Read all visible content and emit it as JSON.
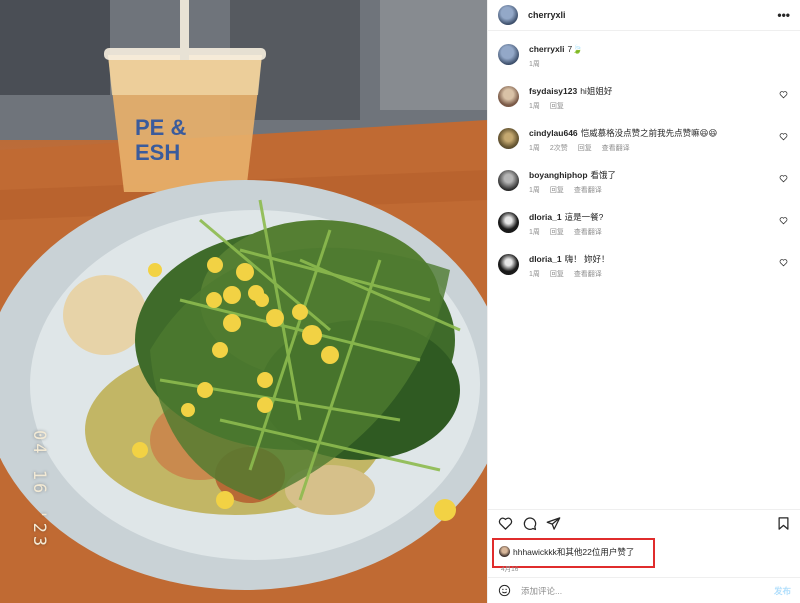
{
  "photo": {
    "date_stamp": "04 16 '23",
    "cup_print": [
      "PE &",
      "ESH"
    ]
  },
  "post": {
    "author": "cherryxli",
    "more_icon": "more-horizontal-icon",
    "caption": {
      "user": "cherryxli",
      "text": "7🍃",
      "time": "1周"
    },
    "comments": [
      {
        "user": "fsydaisy123",
        "text": "hi姐姐好",
        "time": "1周",
        "reply": "回复",
        "translate": ""
      },
      {
        "user": "cindylau646",
        "text": "恺威慕格没点赞之前我先点赞嘛😆😆",
        "time": "1周",
        "likes": "2次赞",
        "reply": "回复",
        "translate": "查看翻译"
      },
      {
        "user": "boyanghiphop",
        "text": "看饿了",
        "time": "1周",
        "reply": "回复",
        "translate": "查看翻译"
      },
      {
        "user": "dloria_1",
        "text": "這是一餐?",
        "time": "1周",
        "reply": "回复",
        "translate": "查看翻译"
      },
      {
        "user": "dloria_1",
        "text": "嗨！ 妳好！",
        "time": "1周",
        "reply": "回复",
        "translate": "查看翻译"
      }
    ],
    "actions": {
      "like_icon": "heart-icon",
      "comment_icon": "comment-icon",
      "share_icon": "send-icon",
      "save_icon": "bookmark-icon"
    },
    "likes_text": "hhhawickkk和其他22位用户赞了",
    "date": "4月16",
    "add_comment": {
      "placeholder": "添加评论...",
      "post_label": "发布"
    }
  },
  "colors": {
    "highlight_box": "#e02c2c",
    "muted_text": "#8e8e8e",
    "post_button": "#b2dffc"
  }
}
